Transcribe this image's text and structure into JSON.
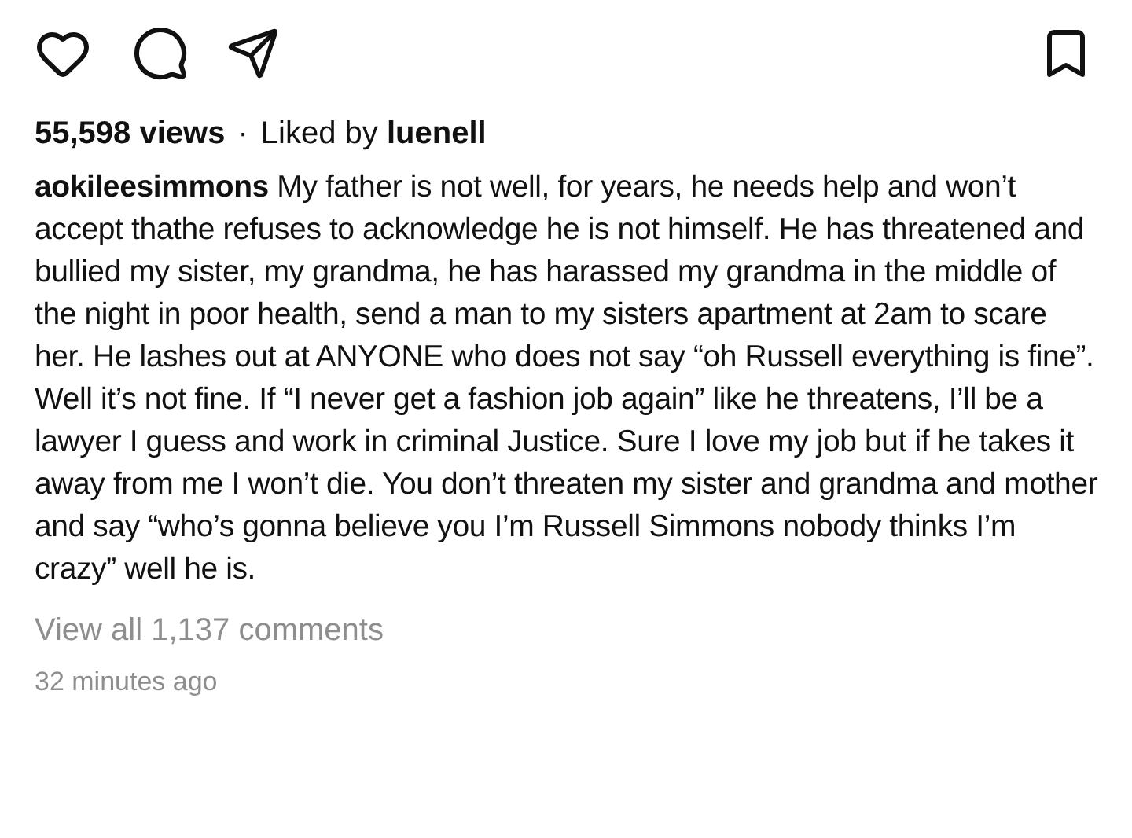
{
  "actions": {
    "liked": false,
    "saved": false
  },
  "stats": {
    "views": "55,598 views",
    "separator": "·",
    "liked_by": "Liked by **luenell**"
  },
  "caption": "**aokileesimmons** My father is not well, for years, he needs help and won’t accept thathe refuses to acknowledge he is not himself. He has threatened and bullied my sister, my grandma, he has harassed my grandma in the middle of the night in poor health, send a man to my sisters apartment at 2am to scare her. He lashes out at ANYONE who does not say “oh Russell everything is fine”. Well it’s not fine. If “I never get a fashion job again” like he threatens, I’ll be a lawyer I guess and work in criminal Justice. Sure I love my job but if he takes it away from me I won’t die. You don’t threaten my sister and grandma and mother and say “who’s gonna believe you I’m Russell Simmons nobody thinks I’m crazy” well he is.",
  "comments_link": "View all 1,137 comments",
  "timestamp": "32 minutes ago"
}
